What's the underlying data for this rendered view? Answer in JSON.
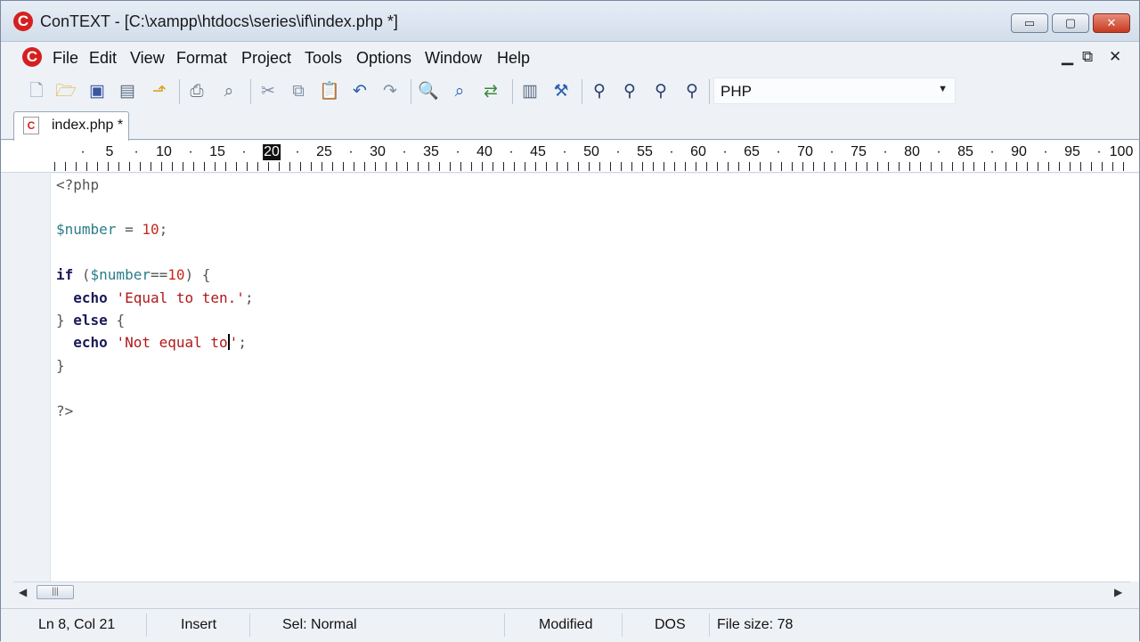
{
  "window": {
    "title": "ConTEXT - [C:\\xampp\\htdocs\\series\\if\\index.php *]",
    "logo_letter": "C",
    "controls": {
      "minimize": "▭",
      "restore": "▢",
      "close": "✕"
    }
  },
  "menu": {
    "items": [
      "File",
      "Edit",
      "View",
      "Format",
      "Project",
      "Tools",
      "Options",
      "Window",
      "Help"
    ],
    "mdi_controls": {
      "minimize": "▁",
      "restore": "⧉",
      "close": "✕"
    }
  },
  "toolbar": {
    "icons": [
      "new-file-icon",
      "open-folder-icon",
      "save-icon",
      "save-all-icon",
      "open-folder-up-icon",
      "print-icon",
      "print-preview-icon",
      "cut-icon",
      "copy-icon",
      "paste-icon",
      "undo-icon",
      "redo-icon",
      "find-icon",
      "find-next-icon",
      "replace-icon",
      "page-setup-icon",
      "tool-icon",
      "user-exec-1-icon",
      "user-exec-2-icon",
      "user-exec-3-icon",
      "user-exec-4-icon"
    ],
    "language_select": {
      "value": "PHP"
    }
  },
  "tabs": [
    {
      "label": "index.php *"
    }
  ],
  "ruler": {
    "numbers": [
      "5",
      "10",
      "15",
      "20",
      "25",
      "30",
      "35",
      "40",
      "45",
      "50",
      "55",
      "60",
      "65",
      "70",
      "75",
      "80",
      "85",
      "90",
      "95",
      "100"
    ],
    "current_column_label": "20"
  },
  "editor": {
    "lines": [
      "<?php",
      "",
      "$number = 10;",
      "",
      "if ($number==10) {",
      "  echo 'Equal to ten.';",
      "} else {",
      "  echo 'Not equal to';",
      "}",
      "",
      "?>"
    ],
    "code": {
      "open_tag": "<?php",
      "var": "$number",
      "assign": " = ",
      "num": "10",
      "semi": ";",
      "if_kw": "if",
      "if_open": " (",
      "eq": "==",
      "if_close": ") {",
      "echo_kw": "echo",
      "str1": "'Equal to ten.'",
      "close_brace": "}",
      "else_kw": "else",
      "open_brace": " {",
      "str2_before_caret": "'Not equal to",
      "str2_after_caret": "'",
      "close_tag": "?>"
    }
  },
  "statusbar": {
    "position": "Ln 8, Col 21",
    "mode": "Insert",
    "selection": "Sel: Normal",
    "modified": "Modified",
    "line_endings": "DOS",
    "file_size": "File size: 78"
  },
  "colors": {
    "keyword": "#1a1a5a",
    "variable": "#2a7d8a",
    "string": "#b01818",
    "number": "#c8281b",
    "logo_red": "#d61f1f"
  }
}
